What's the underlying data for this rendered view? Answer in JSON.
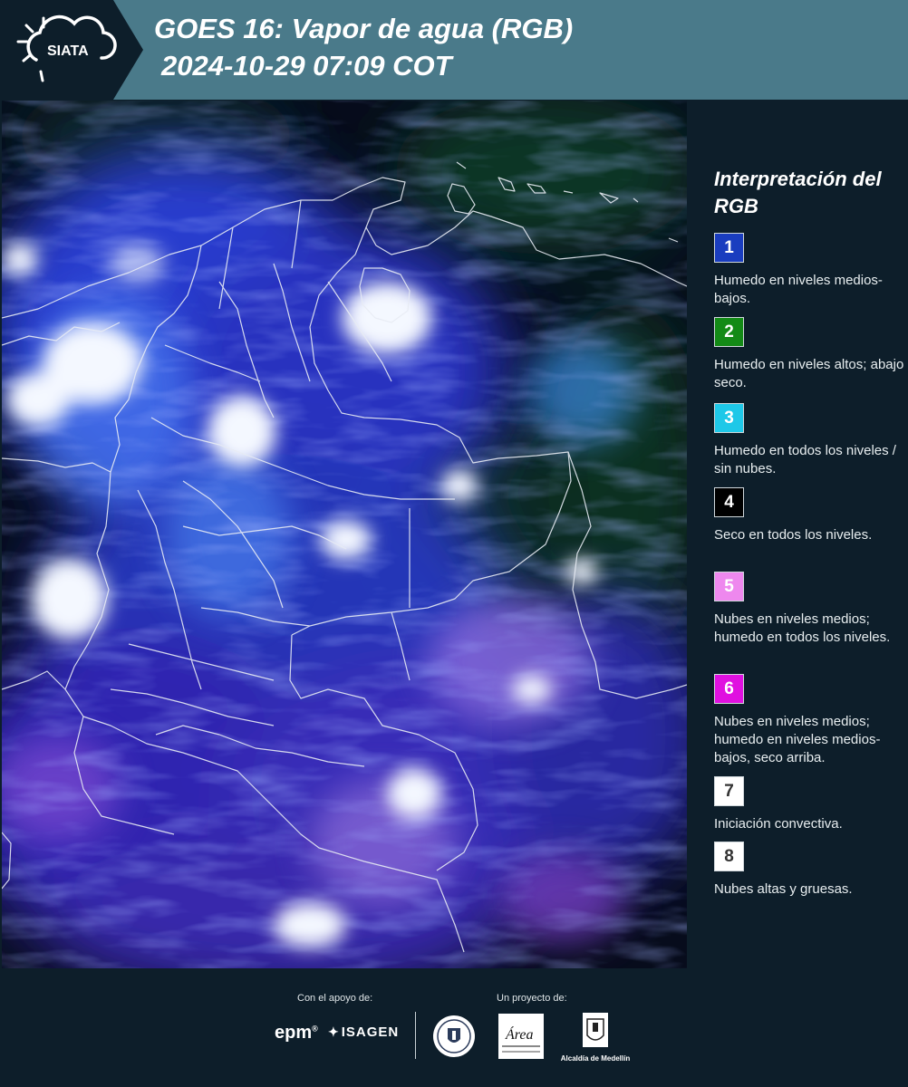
{
  "header": {
    "logo_text": "SIATA",
    "title_line1": "GOES 16: Vapor de agua (RGB)",
    "title_line2": "2024-10-29 07:09 COT"
  },
  "legend": {
    "title": "Interpretación del RGB",
    "items": [
      {
        "number": "1",
        "color": "#1a3dbf",
        "description": "Humedo en niveles medios-bajos."
      },
      {
        "number": "2",
        "color": "#138a16",
        "description": "Humedo en niveles altos; abajo seco."
      },
      {
        "number": "3",
        "color": "#1ec8e8",
        "description": "Humedo en todos los niveles / sin nubes."
      },
      {
        "number": "4",
        "color": "#000000",
        "description": "Seco en todos los niveles."
      },
      {
        "number": "5",
        "color": "#ee88ee",
        "description": "Nubes en niveles medios; humedo en todos los niveles."
      },
      {
        "number": "6",
        "color": "#e010e0",
        "description": "Nubes en niveles medios; humedo en niveles medios-bajos, seco arriba."
      },
      {
        "number": "7",
        "color": "#ffffff",
        "description": "Iniciación convectiva."
      },
      {
        "number": "8",
        "color": "#ffffff",
        "description": "Nubes altas y gruesas."
      }
    ]
  },
  "footer": {
    "support_caption": "Con el apoyo de:",
    "project_caption": "Un proyecto de:",
    "epm_logo": "epm",
    "isagen_logo": "ISAGEN",
    "amva_logo_text": "Área",
    "alcaldia_label": "Alcaldía de Medellín"
  },
  "colors": {
    "header_bg": "#4a7a8a",
    "page_bg": "#0d1e2a",
    "map_bg": "#060a18"
  }
}
